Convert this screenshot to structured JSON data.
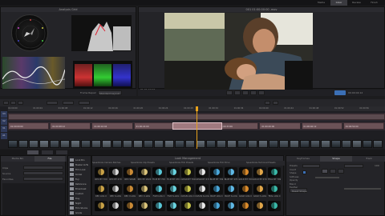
{
  "top_bar": {
    "tabs": [
      "Media",
      "Color",
      "Review",
      "Finish"
    ],
    "active_tab": "Color"
  },
  "scopes_panel": {
    "title": "Analysis Grid"
  },
  "viewer": {
    "title": "001 01:00:00:00 .mov",
    "timecode": "01:01:22:02",
    "timecode_right": "00:00:04:12"
  },
  "controls": {
    "mode_label": "Frame Repair",
    "mode_value": "Standard Layout"
  },
  "timeline": {
    "ruler": [
      "01:00:00",
      "01:00:04",
      "01:00:08",
      "01:00:12",
      "01:00:16",
      "01:00:20",
      "01:00:24",
      "01:00:28",
      "01:00:32",
      "01:00:36",
      "01:00:40",
      "01:00:44",
      "01:00:48",
      "01:00:52",
      "01:00:56"
    ],
    "tracks": [
      "V3",
      "V2",
      "V1",
      "A1"
    ],
    "clip_labels": [
      "01:00:00:00",
      "01:00:08:12",
      "01:00:16:04",
      "01:00:22:00",
      "01:00:28:18",
      "01:00:33:06",
      "01:00:40:00",
      "01:00:46:12",
      "01:00:52:00"
    ]
  },
  "left_panel": {
    "tabs": [
      "Media Bin",
      "File"
    ],
    "active_tab": "File",
    "rows": [
      "Clips",
      "Source",
      "Favorites"
    ]
  },
  "library": {
    "folders": [
      "Look Bin",
      "Master LUTs",
      "Film Look",
      "Kodak",
      "Fuji",
      "Reference",
      "Broadcast",
      "Custom",
      "Day",
      "Night",
      "Film Stocks",
      "Grade"
    ]
  },
  "lut_browser": {
    "title": "Look Management",
    "categories": [
      "Speedlooks Camera Patches",
      "Speedlooks Clip Presets",
      "Speedlooks Film Presets",
      "Speedlooks Film Emul.",
      "Speedlooks Technical Presets"
    ],
    "rows": [
      [
        "REC BT 709",
        "REC BT 470",
        "REC SRGB",
        "REC BT 2020",
        "FILM BT 709",
        "FILM BT 470",
        "CLEAN BT 709",
        "CLEAN BT 470",
        "BLUE BT 709",
        "BLUE BT 470",
        "GOLD BT 709",
        "GOLD BT 470",
        "TEAL BT 709"
      ],
      [
        "REC LOG C",
        "REC S-LOG",
        "REC V-LOG",
        "REC C-LOG",
        "FILM LOG C",
        "FILM S-LOG",
        "CLEAN LOG C",
        "CLEAN S-LOG",
        "BLUE LOG C",
        "BLUE S-LOG",
        "GOLD LOG C",
        "GOLD S-LOG",
        "TEAL LOG C"
      ],
      [
        "",
        "",
        "",
        "",
        "",
        "",
        "",
        "",
        "",
        "",
        "",
        "",
        ""
      ]
    ],
    "colors": [
      "#c9a247",
      "#d7d7d7",
      "#c98a36",
      "#d9c37a",
      "#59c8d8",
      "#6ad4e0",
      "#c7c44a",
      "#e8e8e8",
      "#4aa6d8",
      "#5fb8e5",
      "#d88a2c",
      "#e0a64a",
      "#3ab8a8"
    ]
  },
  "inspector": {
    "tabs": [
      "Keyframes",
      "Shape",
      "Track"
    ],
    "active_tab": "Shape",
    "labels": [
      "Presets",
      "Invert",
      "Shape",
      "Softness",
      "Opacity",
      "Blend",
      "Feather"
    ],
    "button": "Reset Shape",
    "value": "100"
  }
}
